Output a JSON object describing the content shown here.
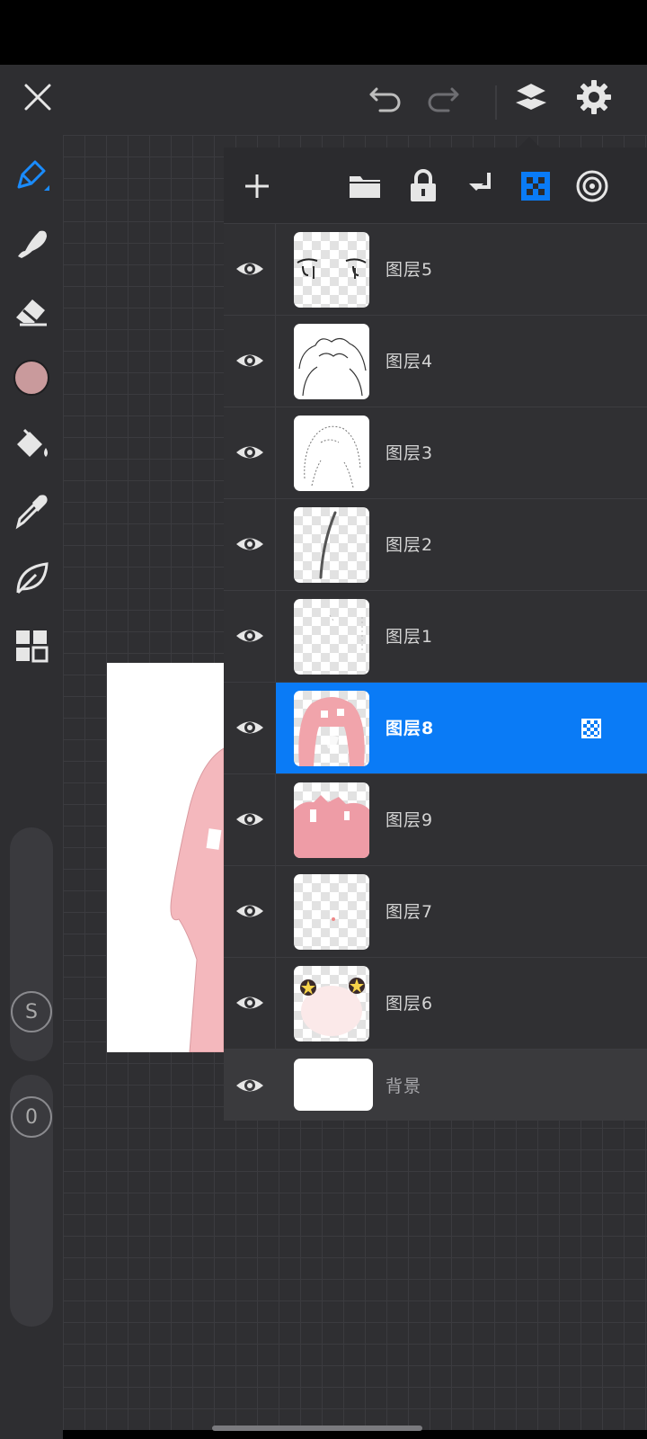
{
  "toolbar": {
    "close_icon": "close-icon",
    "undo_icon": "undo-icon",
    "redo_icon": "redo-icon",
    "layers_icon": "layers-icon",
    "settings_icon": "gear-icon"
  },
  "tools": {
    "items": [
      "pen-icon",
      "smudge-icon",
      "eraser-icon",
      "color-swatch",
      "fill-bucket-icon",
      "eyedropper-icon",
      "leaf-icon",
      "grid-icon"
    ],
    "current_color": "#c99a9c",
    "size_label": "S",
    "opacity_label": "0"
  },
  "layers_toolbar": {
    "icons": [
      "add-layer-icon",
      "folder-icon",
      "lock-icon",
      "merge-down-icon",
      "alpha-lock-icon",
      "blend-mode-icon"
    ],
    "accent": "#0a7bf6"
  },
  "layers": [
    {
      "name": "图层5",
      "selected": false
    },
    {
      "name": "图层4",
      "selected": false
    },
    {
      "name": "图层3",
      "selected": false
    },
    {
      "name": "图层2",
      "selected": false
    },
    {
      "name": "图层1",
      "selected": false
    },
    {
      "name": "图层8",
      "selected": true
    },
    {
      "name": "图层9",
      "selected": false
    },
    {
      "name": "图层7",
      "selected": false
    },
    {
      "name": "图层6",
      "selected": false
    }
  ],
  "background_layer": {
    "name": "背景"
  }
}
